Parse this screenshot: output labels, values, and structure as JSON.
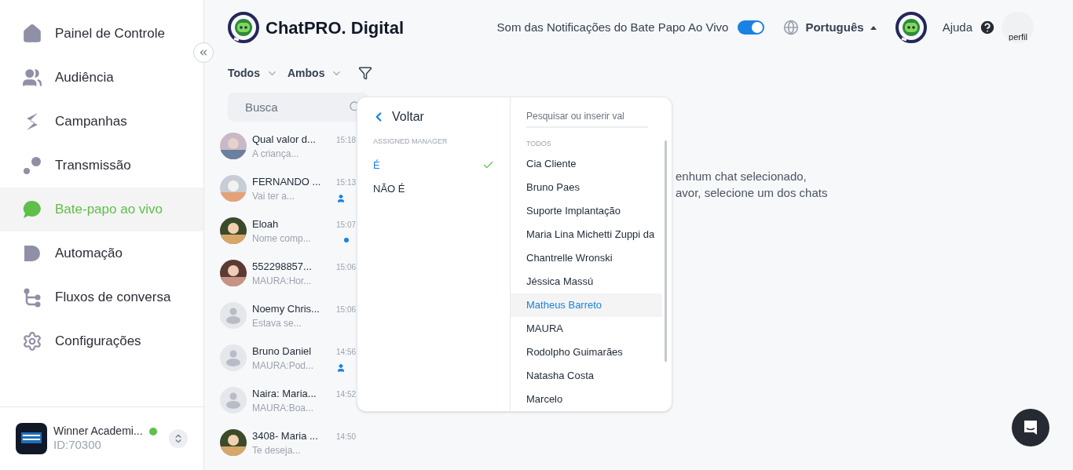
{
  "sidebar": {
    "items": [
      {
        "label": "Painel de Controle",
        "selected": false
      },
      {
        "label": "Audiência",
        "selected": false
      },
      {
        "label": "Campanhas",
        "selected": false
      },
      {
        "label": "Transmissão",
        "selected": false
      },
      {
        "label": "Bate-papo ao vivo",
        "selected": true
      },
      {
        "label": "Automação",
        "selected": false
      },
      {
        "label": "Fluxos de conversa",
        "selected": false
      },
      {
        "label": "Configurações",
        "selected": false
      }
    ],
    "account": {
      "name": "Winner Academi...",
      "id": "ID:70300",
      "online": true
    }
  },
  "header": {
    "brand": "ChatPRO. Digital",
    "sound_label": "Som das Notificações do Bate Papo Ao Vivo",
    "sound_on": true,
    "language": "Português",
    "help": "Ajuda",
    "profile_alt": "perfil"
  },
  "filters": [
    {
      "label": "Todos"
    },
    {
      "label": "Ambos"
    }
  ],
  "search": {
    "placeholder": "Busca"
  },
  "chats": [
    {
      "name": "Qual valor d...",
      "preview": "A criança...",
      "time": "15:18",
      "assigned": false,
      "unread": false
    },
    {
      "name": "FERNANDO ...",
      "preview": "Vai ter a...",
      "time": "15:13",
      "assigned": true,
      "unread": false
    },
    {
      "name": "Eloah",
      "preview": "Nome comp...",
      "time": "15:07",
      "assigned": false,
      "unread": true
    },
    {
      "name": "552298857...",
      "preview": "MAURA:Hor...",
      "time": "15:06",
      "assigned": false,
      "unread": false
    },
    {
      "name": "Noemy Chris...",
      "preview": "Estava se...",
      "time": "15:06",
      "kind": "placeholder",
      "assigned": false,
      "unread": false
    },
    {
      "name": "Bruno Daniel",
      "preview": "MAURA:Pod...",
      "time": "14:56",
      "kind": "placeholder",
      "assigned": true,
      "unread": false
    },
    {
      "name": "Naira: Maria...",
      "preview": "MAURA:Boa...",
      "time": "14:52",
      "kind": "placeholder",
      "assigned": false,
      "unread": false
    },
    {
      "name": "3408- Maria ...",
      "preview": "Te deseja...",
      "time": "14:50",
      "assigned": false,
      "unread": false
    }
  ],
  "empty_state": [
    "enhum chat selecionado,",
    "avor, selecione um dos chats"
  ],
  "filter_menu": {
    "back": "Voltar",
    "section": "ASSIGNED MANAGER",
    "operators": [
      {
        "label": "É",
        "selected": true
      },
      {
        "label": "NÃO É",
        "selected": false
      }
    ],
    "search_placeholder": "Pesquisar ou inserir val",
    "group": "TODOS",
    "values": [
      {
        "label": "Cia Cliente",
        "selected": false
      },
      {
        "label": "Bruno Paes",
        "selected": false
      },
      {
        "label": "Suporte Implantação",
        "selected": false
      },
      {
        "label": "Maria Lina Michetti Zuppi da",
        "selected": false
      },
      {
        "label": "Chantrelle Wronski",
        "selected": false
      },
      {
        "label": "Jéssica Massú",
        "selected": false
      },
      {
        "label": "Matheus Barreto",
        "selected": true
      },
      {
        "label": "MAURA",
        "selected": false
      },
      {
        "label": "Rodolpho Guimarães",
        "selected": false
      },
      {
        "label": "Natasha Costa",
        "selected": false
      },
      {
        "label": "Marcelo",
        "selected": false
      }
    ]
  }
}
